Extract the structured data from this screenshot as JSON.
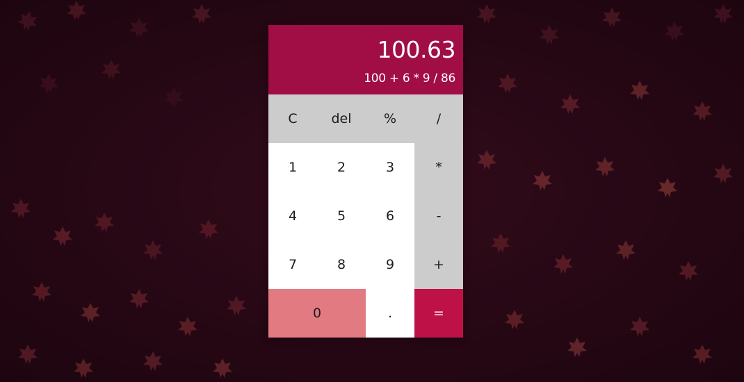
{
  "display": {
    "result": "100.63",
    "expression": "100 + 6 * 9 / 86"
  },
  "keys": {
    "clear": "C",
    "delete": "del",
    "percent": "%",
    "divide": "/",
    "one": "1",
    "two": "2",
    "three": "3",
    "multiply": "*",
    "four": "4",
    "five": "5",
    "six": "6",
    "subtract": "-",
    "seven": "7",
    "eight": "8",
    "nine": "9",
    "add": "+",
    "zero": "0",
    "decimal": ".",
    "equals": "="
  },
  "colors": {
    "display_bg": "#a10d45",
    "function_key_bg": "#cccccc",
    "digit_key_bg": "#ffffff",
    "zero_key_bg": "#e27a82",
    "equals_key_bg": "#be1148",
    "background": "#2a0a16"
  },
  "background_image": "autumn-leaves-photo"
}
